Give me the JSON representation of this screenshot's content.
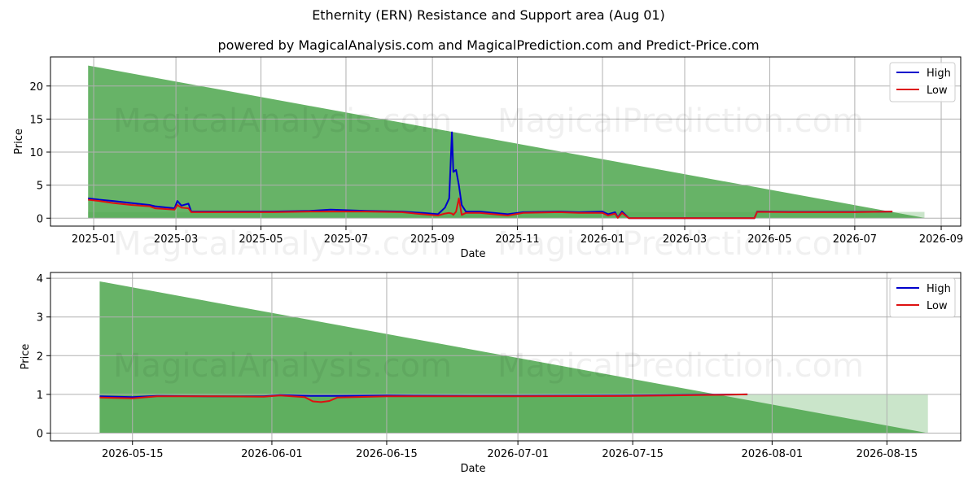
{
  "title": "Ethernity (ERN) Resistance and Support area (Aug 01)",
  "subtitle": "powered by MagicalAnalysis.com and MagicalPrediction.com and Predict-Price.com",
  "watermarks": [
    "MagicalAnalysis.com",
    "MagicalPrediction.com"
  ],
  "colors": {
    "high": "#0000cc",
    "low": "#dd1111",
    "area": "#4ca64c",
    "band": "#9fd09f"
  },
  "chart_data": [
    {
      "type": "line",
      "xlabel": "Date",
      "ylabel": "Price",
      "x_ticks": [
        "2025-01",
        "2025-03",
        "2025-05",
        "2025-07",
        "2025-09",
        "2025-11",
        "2026-01",
        "2026-03",
        "2026-05",
        "2026-07",
        "2026-09"
      ],
      "y_ticks": [
        "0",
        "5",
        "10",
        "15",
        "20"
      ],
      "xlim": [
        "2024-12-01",
        "2026-09-15"
      ],
      "ylim": [
        -1.2,
        24.4
      ],
      "grid": true,
      "legend": "top-right",
      "resistance_area": {
        "start": "2024-12-28",
        "end": "2026-08-20",
        "top_start": 23.1,
        "top_end": 0.05
      },
      "support_band": {
        "start": "2024-12-28",
        "end": "2026-08-20",
        "top": 0.95
      },
      "series": [
        {
          "name": "High",
          "x": [
            "2024-12-28",
            "2025-01-05",
            "2025-01-15",
            "2025-01-28",
            "2025-02-10",
            "2025-02-14",
            "2025-02-28",
            "2025-03-02",
            "2025-03-05",
            "2025-03-10",
            "2025-03-12",
            "2025-04-10",
            "2025-05-10",
            "2025-06-05",
            "2025-06-20",
            "2025-07-15",
            "2025-08-10",
            "2025-08-25",
            "2025-09-05",
            "2025-09-10",
            "2025-09-13",
            "2025-09-15",
            "2025-09-16",
            "2025-09-18",
            "2025-09-20",
            "2025-09-22",
            "2025-09-25",
            "2025-10-05",
            "2025-10-15",
            "2025-10-25",
            "2025-11-05",
            "2025-12-01",
            "2025-12-15",
            "2026-01-01",
            "2026-01-05",
            "2026-01-10",
            "2026-01-12",
            "2026-01-15",
            "2026-01-20",
            "2026-04-20",
            "2026-04-22",
            "2026-05-15",
            "2026-06-15",
            "2026-07-01",
            "2026-07-28"
          ],
          "values": [
            3.0,
            2.8,
            2.6,
            2.3,
            2.0,
            1.8,
            1.5,
            2.6,
            1.9,
            2.2,
            1.0,
            1.0,
            1.0,
            1.1,
            1.3,
            1.1,
            1.0,
            0.8,
            0.6,
            1.6,
            3.0,
            13.0,
            7.0,
            7.3,
            5.0,
            2.0,
            1.0,
            1.0,
            0.8,
            0.6,
            0.9,
            1.0,
            0.9,
            1.0,
            0.6,
            0.9,
            0.1,
            1.0,
            0.0,
            0.0,
            1.0,
            0.95,
            0.95,
            0.95,
            1.0
          ]
        },
        {
          "name": "Low",
          "x": [
            "2024-12-28",
            "2025-01-05",
            "2025-01-15",
            "2025-01-28",
            "2025-02-10",
            "2025-02-14",
            "2025-02-28",
            "2025-03-02",
            "2025-03-05",
            "2025-03-10",
            "2025-03-12",
            "2025-04-10",
            "2025-05-10",
            "2025-06-05",
            "2025-06-20",
            "2025-07-15",
            "2025-08-10",
            "2025-08-25",
            "2025-09-05",
            "2025-09-10",
            "2025-09-13",
            "2025-09-15",
            "2025-09-16",
            "2025-09-18",
            "2025-09-20",
            "2025-09-22",
            "2025-09-25",
            "2025-10-05",
            "2025-10-15",
            "2025-10-25",
            "2025-11-05",
            "2025-12-01",
            "2025-12-15",
            "2026-01-01",
            "2026-01-05",
            "2026-01-10",
            "2026-01-12",
            "2026-01-15",
            "2026-01-20",
            "2026-04-20",
            "2026-04-22",
            "2026-05-15",
            "2026-06-15",
            "2026-07-01",
            "2026-07-28"
          ],
          "values": [
            2.8,
            2.6,
            2.3,
            2.0,
            1.8,
            1.5,
            1.3,
            2.0,
            1.6,
            1.5,
            0.9,
            0.9,
            0.9,
            1.0,
            1.0,
            1.0,
            0.9,
            0.6,
            0.4,
            0.7,
            0.8,
            0.7,
            0.5,
            1.0,
            3.0,
            0.5,
            0.8,
            0.8,
            0.6,
            0.4,
            0.8,
            0.9,
            0.8,
            0.8,
            0.4,
            0.7,
            0.05,
            0.8,
            0.0,
            0.0,
            0.95,
            0.9,
            0.9,
            0.9,
            1.0
          ]
        }
      ]
    },
    {
      "type": "line",
      "xlabel": "Date",
      "ylabel": "Price",
      "x_ticks": [
        "2026-05-15",
        "2026-06-01",
        "2026-06-15",
        "2026-07-01",
        "2026-07-15",
        "2026-08-01",
        "2026-08-15"
      ],
      "y_ticks": [
        "0",
        "1",
        "2",
        "3",
        "4"
      ],
      "xlim": [
        "2026-05-05",
        "2026-08-24"
      ],
      "ylim": [
        -0.2,
        4.15
      ],
      "grid": true,
      "legend": "top-right",
      "resistance_area": {
        "start": "2026-05-11",
        "end": "2026-08-20",
        "top_start": 3.92,
        "top_end": 0.0
      },
      "support_band": {
        "start": "2026-05-11",
        "end": "2026-08-20",
        "top": 1.0
      },
      "series": [
        {
          "name": "High",
          "x": [
            "2026-05-11",
            "2026-05-15",
            "2026-05-18",
            "2026-05-25",
            "2026-05-31",
            "2026-06-02",
            "2026-06-06",
            "2026-06-09",
            "2026-06-15",
            "2026-06-25",
            "2026-07-01",
            "2026-07-15",
            "2026-07-23",
            "2026-07-29"
          ],
          "values": [
            0.95,
            0.93,
            0.96,
            0.95,
            0.95,
            0.98,
            0.96,
            0.96,
            0.97,
            0.96,
            0.96,
            0.97,
            0.99,
            1.0
          ]
        },
        {
          "name": "Low",
          "x": [
            "2026-05-11",
            "2026-05-15",
            "2026-05-18",
            "2026-05-25",
            "2026-05-31",
            "2026-06-02",
            "2026-06-05",
            "2026-06-06",
            "2026-06-07",
            "2026-06-08",
            "2026-06-09",
            "2026-06-15",
            "2026-06-25",
            "2026-07-01",
            "2026-07-15",
            "2026-07-23",
            "2026-07-29"
          ],
          "values": [
            0.92,
            0.9,
            0.95,
            0.95,
            0.94,
            0.97,
            0.93,
            0.82,
            0.8,
            0.83,
            0.92,
            0.95,
            0.95,
            0.95,
            0.96,
            0.98,
            1.0
          ]
        }
      ]
    }
  ]
}
